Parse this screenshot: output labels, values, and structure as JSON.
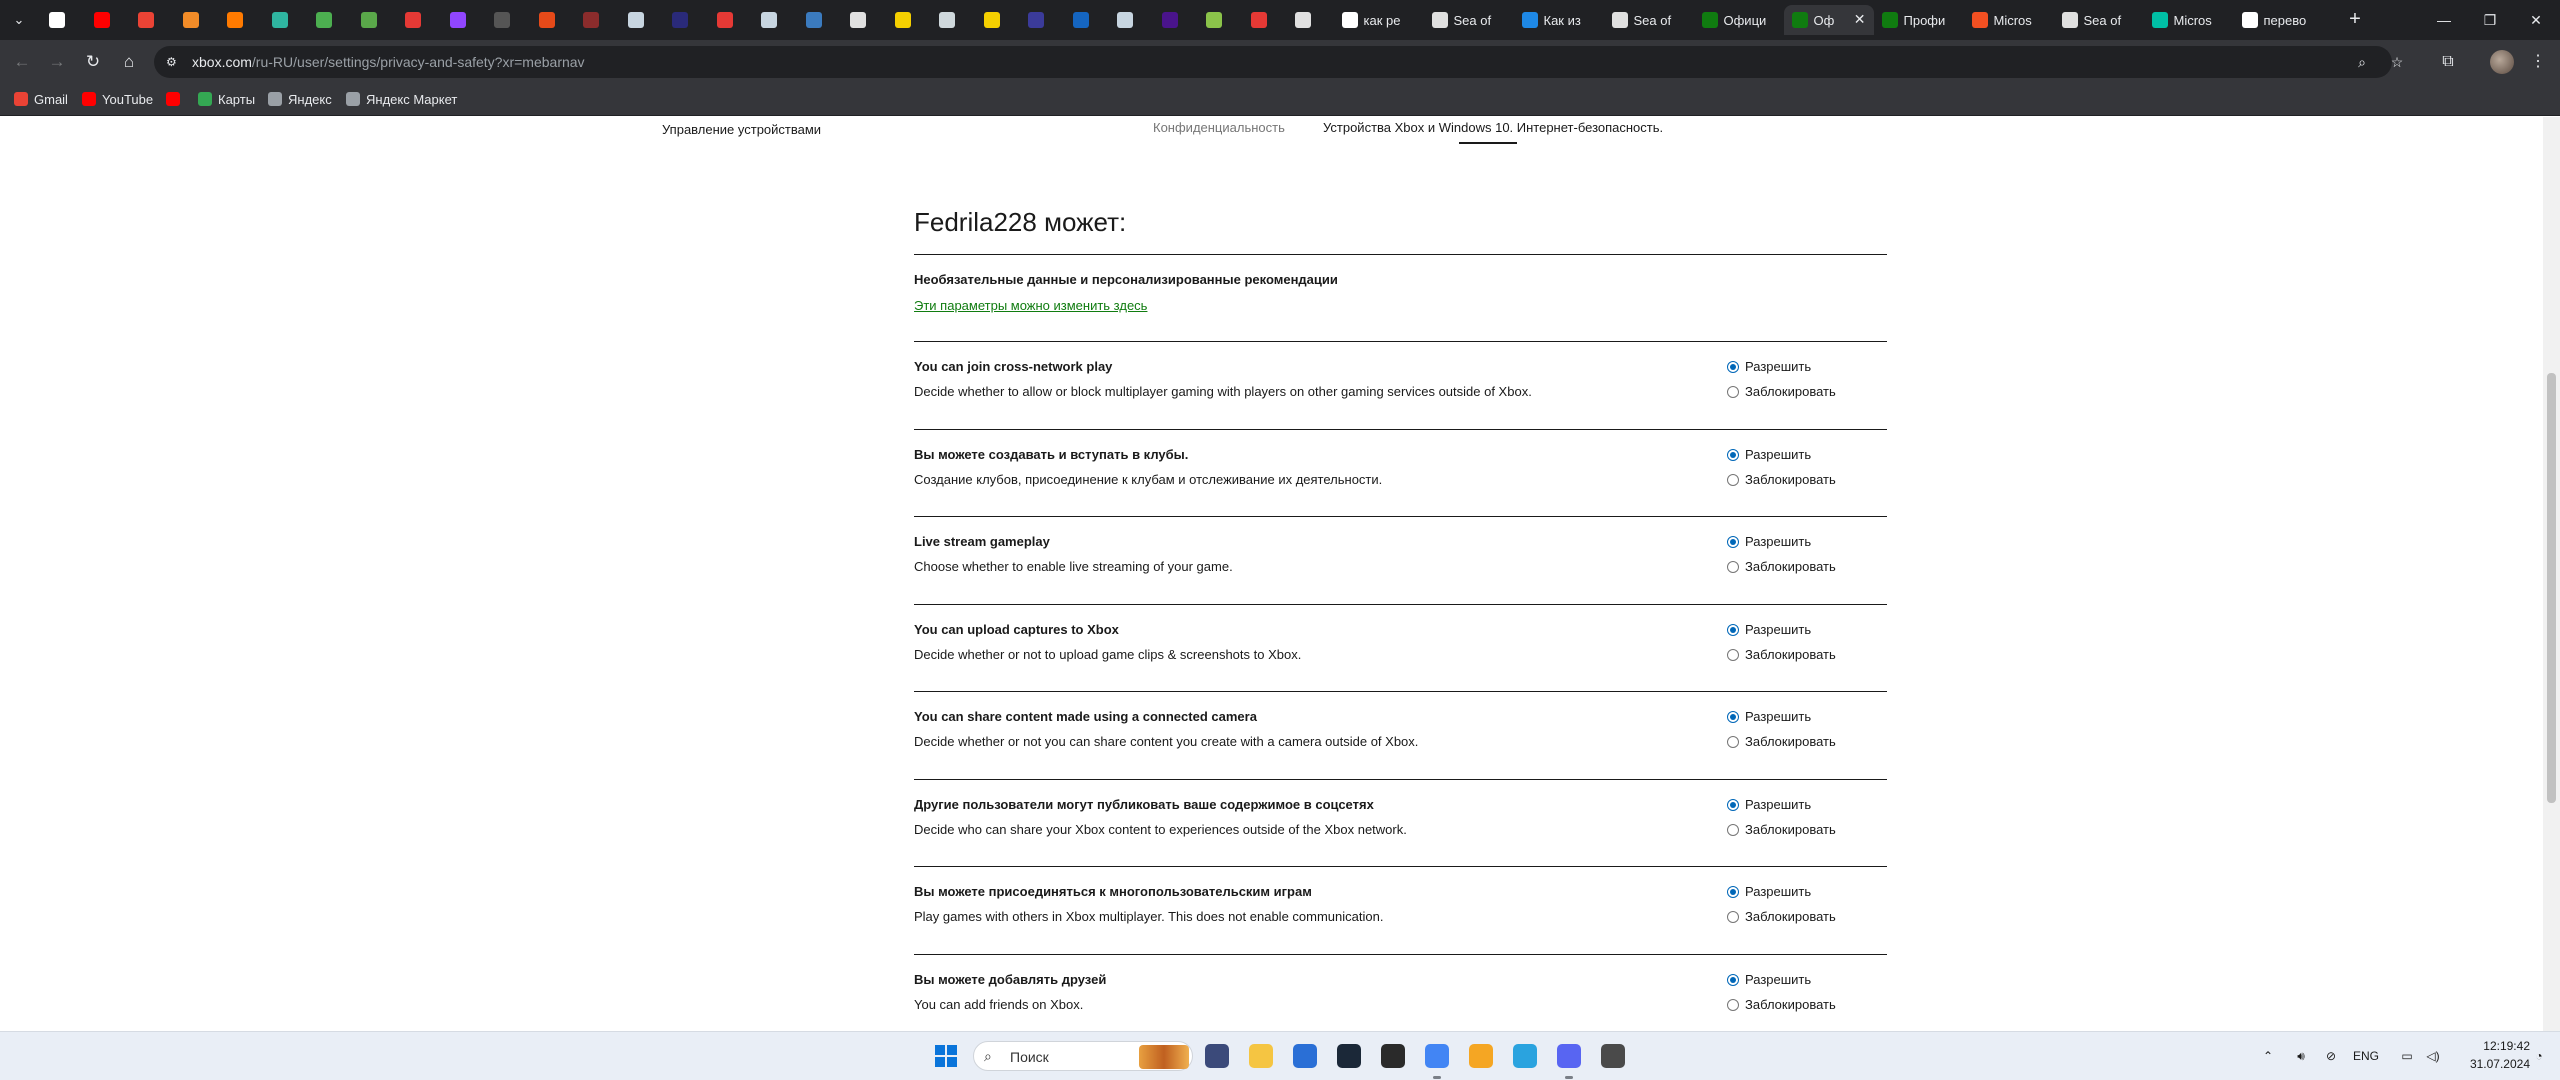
{
  "browser": {
    "tabs": [
      {
        "icon": "google-icon",
        "color": "#ffffff",
        "title": ""
      },
      {
        "icon": "youtube-icon",
        "color": "#ff0000",
        "title": ""
      },
      {
        "icon": "gmail-icon",
        "color": "#ea4335",
        "title": ""
      },
      {
        "icon": "dns-icon",
        "color": "#f28c28",
        "title": ""
      },
      {
        "icon": "fire-icon",
        "color": "#ff7a00",
        "title": ""
      },
      {
        "icon": "puzzle-icon",
        "color": "#2fb5a0",
        "title": ""
      },
      {
        "icon": "pepe-icon",
        "color": "#4caf50",
        "title": ""
      },
      {
        "icon": "pepe-icon",
        "color": "#5aa84a",
        "title": ""
      },
      {
        "icon": "play-icon",
        "color": "#e53935",
        "title": ""
      },
      {
        "icon": "twitch-icon",
        "color": "#9146ff",
        "title": ""
      },
      {
        "icon": "gun-icon",
        "color": "#555555",
        "title": ""
      },
      {
        "icon": "kick-icon",
        "color": "#e64a19",
        "title": ""
      },
      {
        "icon": "shield-icon",
        "color": "#8b2c2c",
        "title": ""
      },
      {
        "icon": "steam-icon",
        "color": "#c7d5e0",
        "title": ""
      },
      {
        "icon": "game-icon",
        "color": "#2a2a7a",
        "title": ""
      },
      {
        "icon": "star-icon",
        "color": "#e53935",
        "title": ""
      },
      {
        "icon": "steam-icon",
        "color": "#c7d5e0",
        "title": ""
      },
      {
        "icon": "paypal-icon",
        "color": "#3b7bbf",
        "title": ""
      },
      {
        "icon": "d-icon",
        "color": "#e0e0e0",
        "title": ""
      },
      {
        "icon": "wb-icon",
        "color": "#f5d000",
        "title": ""
      },
      {
        "icon": "square-icon",
        "color": "#cfd8dc",
        "title": ""
      },
      {
        "icon": "folder-icon",
        "color": "#f5d000",
        "title": ""
      },
      {
        "icon": "game-icon",
        "color": "#3b3b9a",
        "title": ""
      },
      {
        "icon": "ps-icon",
        "color": "#1565c0",
        "title": ""
      },
      {
        "icon": "steam-icon",
        "color": "#c7d5e0",
        "title": ""
      },
      {
        "icon": "user-icon",
        "color": "#4a148c",
        "title": ""
      },
      {
        "icon": "leaf-icon",
        "color": "#8bc34a",
        "title": ""
      },
      {
        "icon": "ya-icon",
        "color": "#e53935",
        "title": ""
      },
      {
        "icon": "loop-icon",
        "color": "#e0e0e0",
        "title": ""
      },
      {
        "icon": "google-icon",
        "color": "#ffffff",
        "title": "как ре"
      },
      {
        "icon": "sea-icon",
        "color": "#e0e0e0",
        "title": "Sea of"
      },
      {
        "icon": "info-icon",
        "color": "#1e88e5",
        "title": "Как из"
      },
      {
        "icon": "sea-icon",
        "color": "#e0e0e0",
        "title": "Sea of"
      },
      {
        "icon": "xbox-icon",
        "color": "#107c10",
        "title": "Офици"
      },
      {
        "icon": "xbox-icon",
        "color": "#107c10",
        "title": "Оф",
        "active": true
      },
      {
        "icon": "xbox-icon",
        "color": "#107c10",
        "title": "Профи"
      },
      {
        "icon": "microsoft-icon",
        "color": "#f25022",
        "title": "Micros"
      },
      {
        "icon": "sea-icon",
        "color": "#e0e0e0",
        "title": "Sea of"
      },
      {
        "icon": "heart-icon",
        "color": "#00bfa5",
        "title": "Micros"
      },
      {
        "icon": "google-icon",
        "color": "#ffffff",
        "title": "перево"
      }
    ],
    "url_host": "xbox.com",
    "url_path": "/ru-RU/user/settings/privacy-and-safety?xr=mebarnav",
    "bookmarks": [
      {
        "label": "Gmail",
        "icon": "gmail-icon",
        "color": "#ea4335"
      },
      {
        "label": "YouTube",
        "icon": "youtube-icon",
        "color": "#ff0000"
      },
      {
        "label": "",
        "icon": "youtube-icon",
        "color": "#ff0000"
      },
      {
        "label": "Карты",
        "icon": "maps-icon",
        "color": "#34a853"
      },
      {
        "label": "Яндекс",
        "icon": "globe-icon",
        "color": "#9aa0a6"
      },
      {
        "label": "Яндекс Маркет",
        "icon": "globe-icon",
        "color": "#9aa0a6"
      }
    ]
  },
  "page": {
    "subnav": {
      "devices": "Управление устройствами",
      "privacy": "Конфиденциальность",
      "safety": "Устройства Xbox и Windows 10. Интернет-безопасность."
    },
    "heading": "Fedrila228 может:",
    "optional": {
      "title": "Необязательные данные и персонализированные рекомендации",
      "link": "Эти параметры можно изменить здесь"
    },
    "allow_label": "Разрешить",
    "block_label": "Заблокировать",
    "settings": [
      {
        "title": "You can join cross-network play",
        "desc": "Decide whether to allow or block multiplayer gaming with players on other gaming services outside of Xbox.",
        "value": "allow"
      },
      {
        "title": "Вы можете создавать и вступать в клубы.",
        "desc": "Создание клубов, присоединение к клубам и отслеживание их деятельности.",
        "value": "allow"
      },
      {
        "title": "Live stream gameplay",
        "desc": "Choose whether to enable live streaming of your game.",
        "value": "allow"
      },
      {
        "title": "You can upload captures to Xbox",
        "desc": "Decide whether or not to upload game clips & screenshots to Xbox.",
        "value": "allow"
      },
      {
        "title": "You can share content made using a connected camera",
        "desc": "Decide whether or not you can share content you create with a camera outside of Xbox.",
        "value": "allow"
      },
      {
        "title": "Другие пользователи могут публиковать ваше содержимое в соцсетях",
        "desc": "Decide who can share your Xbox content to experiences outside of the Xbox network.",
        "value": "allow"
      },
      {
        "title": "Вы можете присоединяться к многопользовательским играм",
        "desc": "Play games with others in Xbox multiplayer. This does not enable communication.",
        "value": "allow"
      },
      {
        "title": "Вы можете добавлять друзей",
        "desc": "You can add friends on Xbox.",
        "value": "allow"
      }
    ]
  },
  "taskbar": {
    "search_placeholder": "Поиск",
    "apps": [
      {
        "icon": "sticker-icon",
        "color": "#3b4a7a"
      },
      {
        "icon": "file-explorer-icon",
        "color": "#f5c542"
      },
      {
        "icon": "store-icon",
        "color": "#2a6fd6"
      },
      {
        "icon": "steam-icon",
        "color": "#1b2838"
      },
      {
        "icon": "epic-games-icon",
        "color": "#2a2a2a"
      },
      {
        "icon": "chrome-icon",
        "color": "#4285f4"
      },
      {
        "icon": "yandex-browser-icon",
        "color": "#f5a623"
      },
      {
        "icon": "telegram-icon",
        "color": "#2aa3df"
      },
      {
        "icon": "discord-icon",
        "color": "#5865f2"
      },
      {
        "icon": "game-app-icon",
        "color": "#4a4a4a"
      }
    ],
    "language": "ENG",
    "time": "12:19:42",
    "date": "31.07.2024"
  }
}
